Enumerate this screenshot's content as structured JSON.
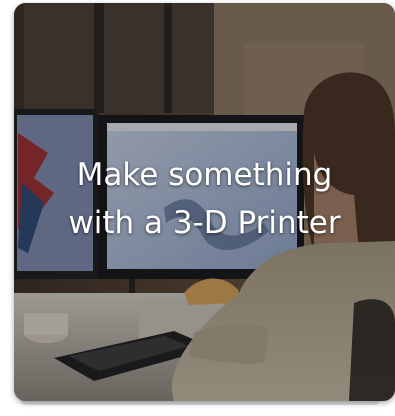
{
  "card": {
    "title_line_1": "Make something",
    "title_line_2": "with a 3-D Printer"
  },
  "colors": {
    "title_text": "#ffffff",
    "screen_glow": "#9fb4d6",
    "sweater": "#b9ad97"
  },
  "icons": [
    "photo-image"
  ]
}
